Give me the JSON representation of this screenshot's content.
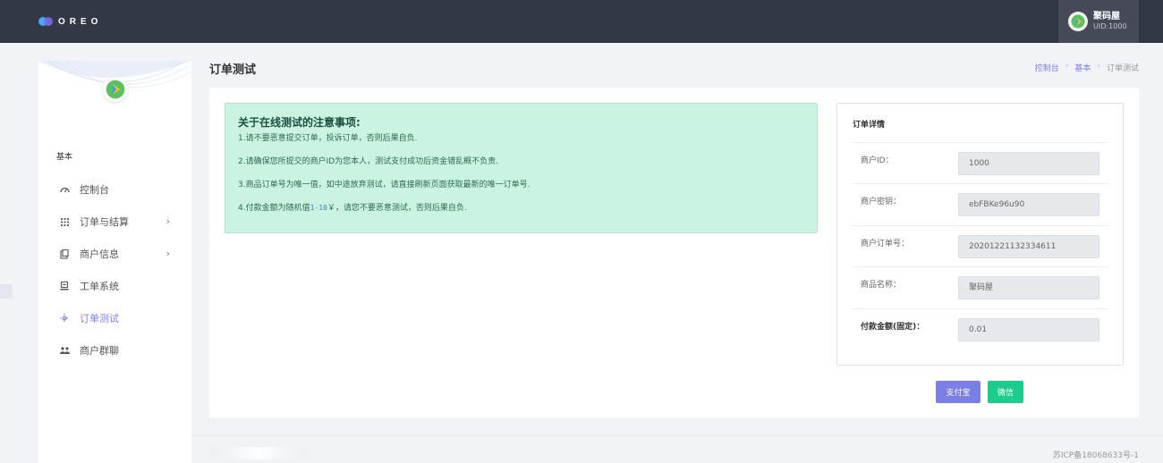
{
  "topbar": {
    "logo_text": "OREO",
    "user_name": "聚码屋",
    "user_uid": "UID:1000"
  },
  "sidebar": {
    "section_label": "基本",
    "items": [
      {
        "label": "控制台",
        "icon": "dashboard-icon",
        "has_submenu": false,
        "active": false
      },
      {
        "label": "订单与结算",
        "icon": "grid-icon",
        "has_submenu": true,
        "active": false
      },
      {
        "label": "商户信息",
        "icon": "clipboard-icon",
        "has_submenu": true,
        "active": false
      },
      {
        "label": "工单系统",
        "icon": "ticket-icon",
        "has_submenu": false,
        "active": false
      },
      {
        "label": "订单测试",
        "icon": "test-icon",
        "has_submenu": false,
        "active": true
      },
      {
        "label": "商户群聊",
        "icon": "group-icon",
        "has_submenu": false,
        "active": false
      }
    ]
  },
  "page": {
    "title": "订单测试",
    "breadcrumb": [
      "控制台",
      "基本",
      "订单测试"
    ]
  },
  "notice": {
    "title": "关于在线测试的注意事项:",
    "lines": [
      "1.请不要恶意提交订单，投诉订单，否则后果自负.",
      "2.请确保您所提交的商户ID为您本人，测试支付成功后资金错乱概不负责.",
      "3.商品订单号为唯一值，如中途放弃测试，请直接刷新页面获取最新的唯一订单号.",
      "4.付款金额为随机值"
    ],
    "line4_range": "1-10",
    "line4_suffix": "￥，请您不要恶意测试，否则后果自负."
  },
  "order_detail": {
    "title": "订单详情",
    "fields": [
      {
        "label": "商户ID：",
        "value": "1000"
      },
      {
        "label": "商户密钥：",
        "value": "ebFBKe96u90"
      },
      {
        "label": "商户订单号：",
        "value": "20201221132334611"
      },
      {
        "label": "商品名称：",
        "value": "聚码屋"
      },
      {
        "label": "付款金额(固定)：",
        "value": "0.01"
      }
    ]
  },
  "buttons": {
    "alipay": "支付宝",
    "wechat": "微信"
  },
  "footer": {
    "icp": "苏ICP备18068633号-1"
  },
  "colors": {
    "topbar": "#333846",
    "accent": "#7b7fe4",
    "wechat": "#1ccc8d",
    "notice_bg": "#cbf3e2"
  }
}
